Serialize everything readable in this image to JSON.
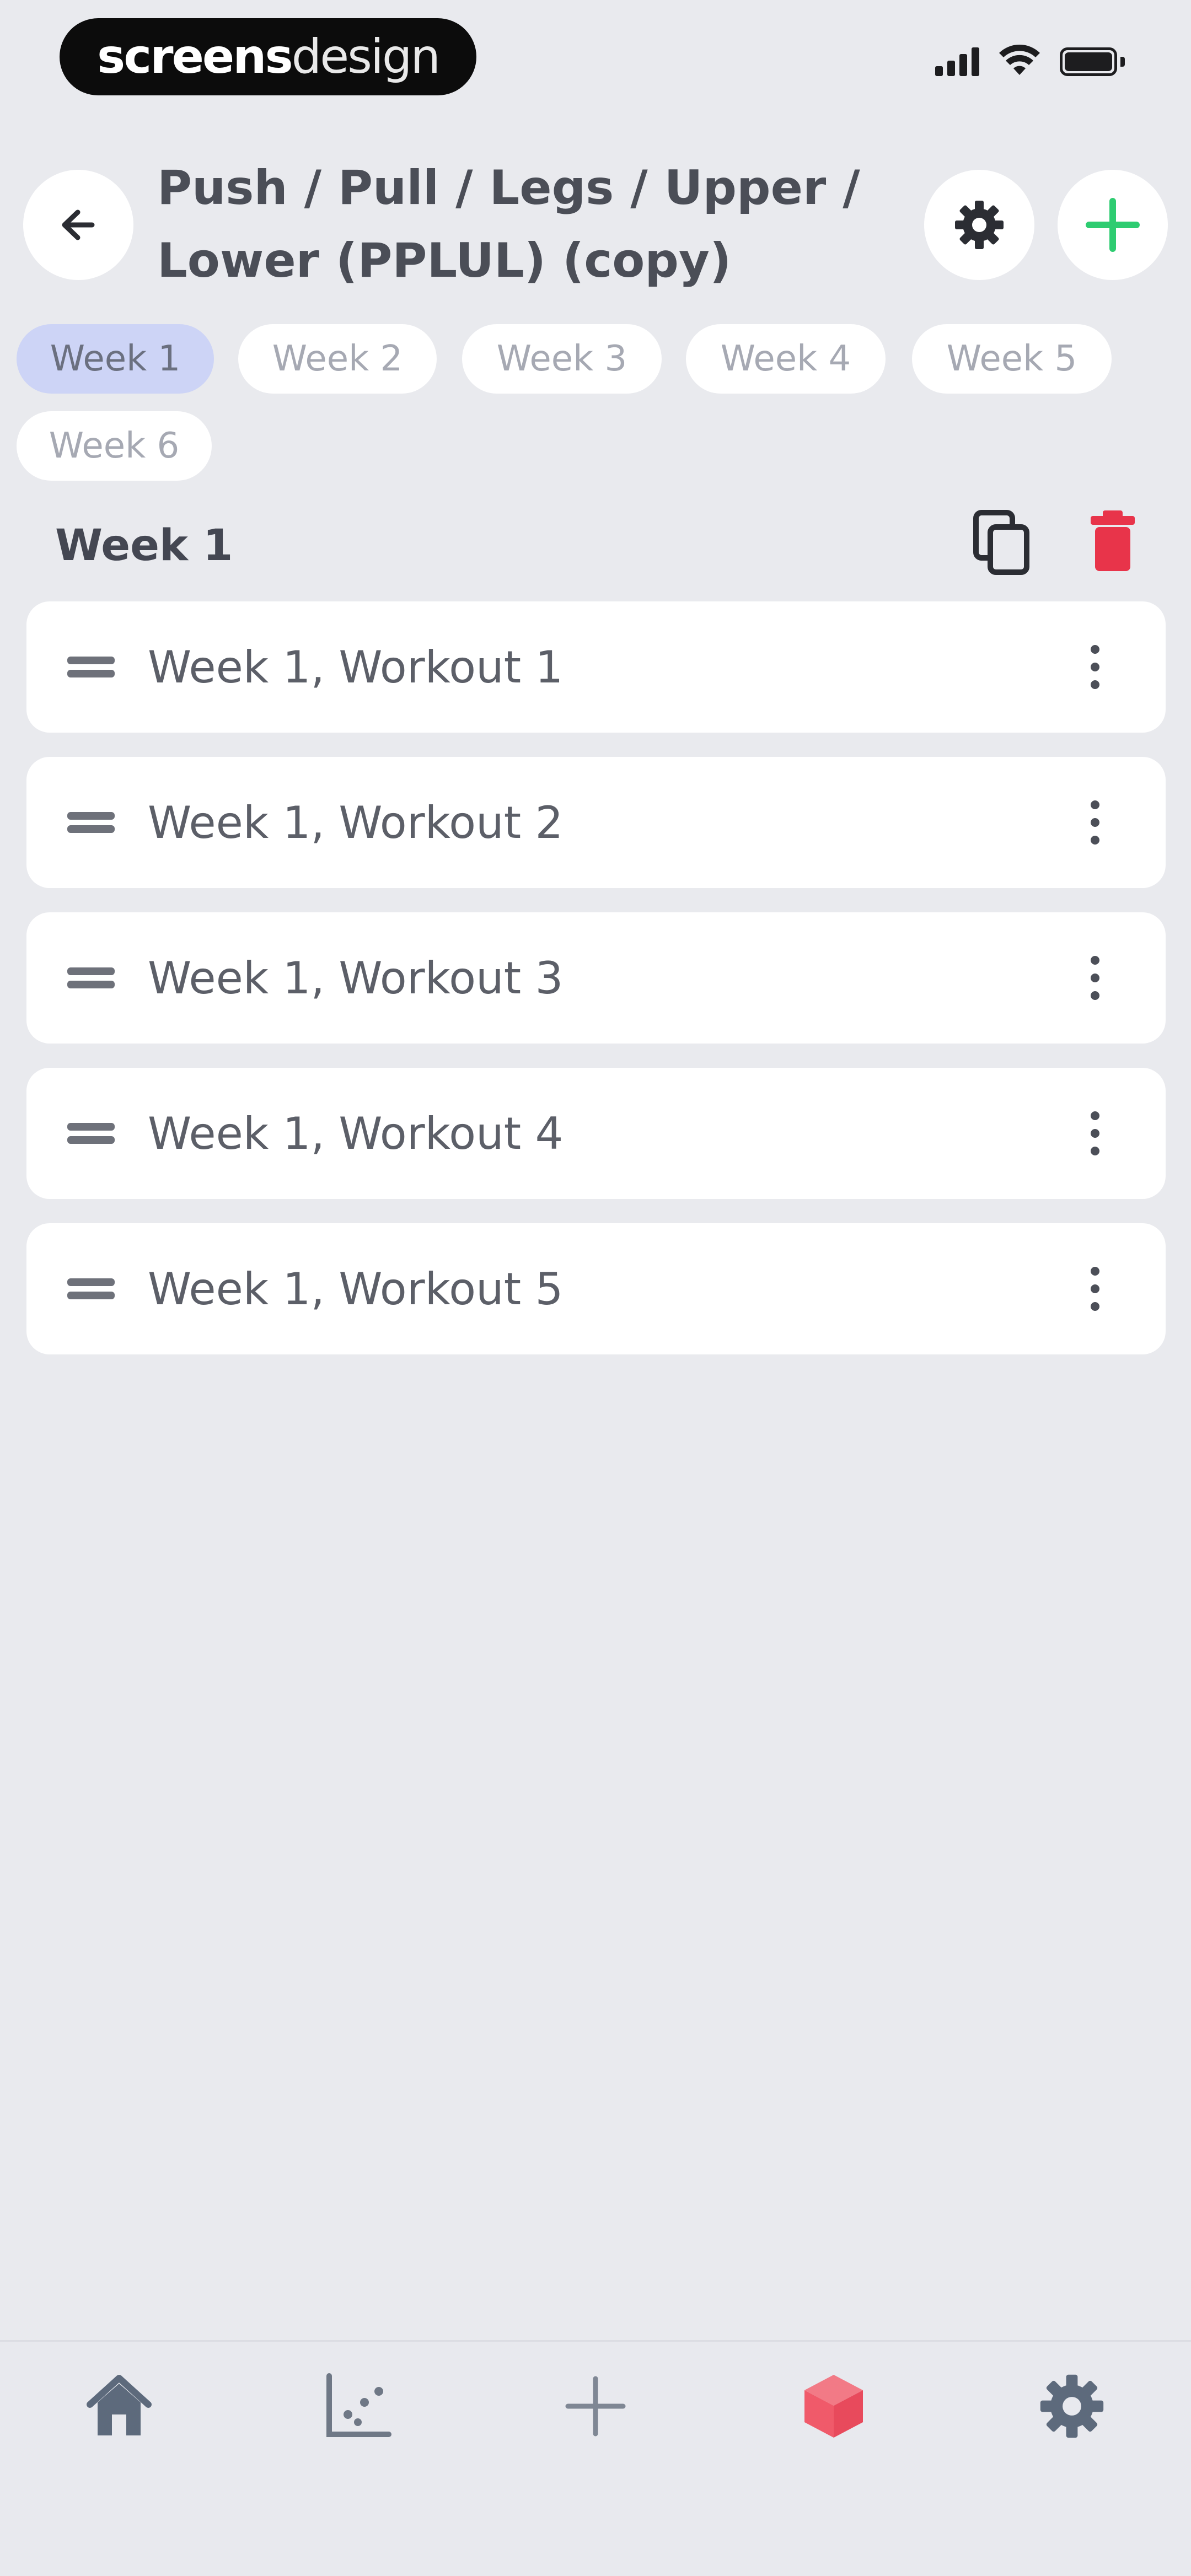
{
  "status_bar": {
    "brand_bold": "screens",
    "brand_light": "design"
  },
  "header": {
    "title": "Push / Pull / Legs / Upper / Lower (PPLUL) (copy)",
    "back_icon": "arrow-left-icon",
    "settings_icon": "gear-icon",
    "add_icon": "plus-icon",
    "add_color": "#2ecc71"
  },
  "weeks": {
    "tabs": [
      {
        "label": "Week 1",
        "active": true
      },
      {
        "label": "Week 2",
        "active": false
      },
      {
        "label": "Week 3",
        "active": false
      },
      {
        "label": "Week 4",
        "active": false
      },
      {
        "label": "Week 5",
        "active": false
      },
      {
        "label": "Week 6",
        "active": false
      }
    ],
    "active_color": "#cdd4f6"
  },
  "section": {
    "title": "Week 1",
    "copy_icon": "copy-icon",
    "delete_icon": "trash-icon",
    "delete_color": "#e8344a"
  },
  "workouts": [
    {
      "label": "Week 1, Workout 1"
    },
    {
      "label": "Week 1, Workout 2"
    },
    {
      "label": "Week 1, Workout 3"
    },
    {
      "label": "Week 1, Workout 4"
    },
    {
      "label": "Week 1, Workout 5"
    }
  ],
  "bottom_nav": {
    "items": [
      {
        "icon": "home-icon"
      },
      {
        "icon": "chart-icon"
      },
      {
        "icon": "plus-icon"
      },
      {
        "icon": "cube-icon",
        "active": true,
        "color": "#f05a6a"
      },
      {
        "icon": "gear-icon"
      }
    ]
  }
}
